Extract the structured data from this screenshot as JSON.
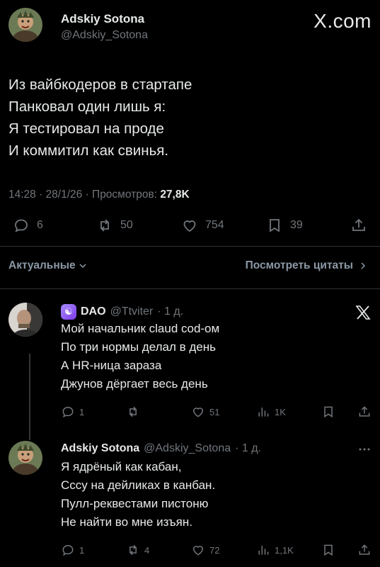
{
  "post": {
    "author_name": "Adskiy Sotona",
    "author_handle": "@Adskiy_Sotona",
    "site_label": "X.com",
    "lines": [
      "Из вайбкодеров в стартапе",
      "Панковал один лишь я:",
      "Я тестировал на проде",
      "И коммитил как свинья."
    ],
    "meta_text": "14:28 · 28/1/26 · Просмотров: ",
    "views": "27,8K",
    "stats": {
      "replies": "6",
      "reposts": "50",
      "likes": "754",
      "bookmarks": "39"
    }
  },
  "sort": {
    "left_label": "Актуальные",
    "right_label": "Посмотреть цитаты"
  },
  "replies": [
    {
      "name": "DAO",
      "handle": "@Ttviter",
      "time": "· 1 д.",
      "lines": [
        "Мой начальник claud cod-ом",
        "По три нормы делал в день",
        "А HR-ница зараза",
        "Джунов дёргает весь день"
      ],
      "stats": {
        "replies": "1",
        "reposts": "",
        "likes": "51",
        "views": "1K"
      },
      "badge_icon": "yin-yang-icon",
      "corner_icon": "x-logo-icon"
    },
    {
      "name": "Adskiy Sotona",
      "handle": "@Adskiy_Sotona",
      "time": "· 1 д.",
      "lines": [
        "Я ядрёный как кабан,",
        "Сссу на дейликах в канбан.",
        "Пулл-реквестами пистоню",
        "Не найти во мне изъян."
      ],
      "stats": {
        "replies": "1",
        "reposts": "4",
        "likes": "72",
        "views": "1,1K"
      },
      "corner_icon": "more-icon"
    }
  ],
  "colors": {
    "background": "#000000",
    "text": "#e7e9ea",
    "muted": "#71767b",
    "divider": "#2f3336"
  }
}
